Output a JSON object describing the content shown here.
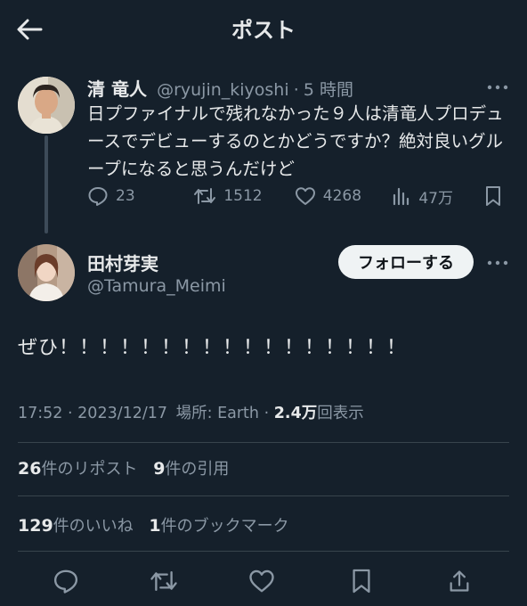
{
  "header": {
    "title": "ポスト"
  },
  "parent_post": {
    "author_name": "清 竜人",
    "handle": "@ryujin_kiyoshi",
    "separator": "·",
    "time": "5 時間",
    "text": "日プファイナルで残れなかった９人は清竜人プロデュースでデビューするのとかどうですか？絶対良いグループになると思うんだけど",
    "replies": "23",
    "reposts": "1512",
    "likes": "4268",
    "views": "47万"
  },
  "main_post": {
    "author_name": "田村芽実",
    "handle": "@Tamura_Meimi",
    "follow_label": "フォローする",
    "text": "ぜひ！！！！！！！！！！！！！！！！！",
    "time": "17:52",
    "dot1": "·",
    "date": "2023/12/17",
    "location_label": "場所: Earth",
    "dot2": "·",
    "view_count": "2.4万",
    "view_label": "回表示",
    "repost_count": "26",
    "repost_label": "件のリポスト",
    "quote_count": "9",
    "quote_label": "件の引用",
    "like_count": "129",
    "like_label": "件のいいね",
    "bookmark_count": "1",
    "bookmark_label": "件のブックマーク"
  },
  "icons": {
    "back": "arrow-left-icon",
    "reply": "reply-icon",
    "repost": "repost-icon",
    "like": "heart-icon",
    "views": "analytics-icon",
    "bookmark": "bookmark-icon",
    "share": "share-icon",
    "more": "more-icon"
  },
  "colors": {
    "background": "#15202b",
    "text": "#e7e9ea",
    "muted": "#8b98a5",
    "divider": "#38444d",
    "button_bg": "#eff3f4"
  }
}
